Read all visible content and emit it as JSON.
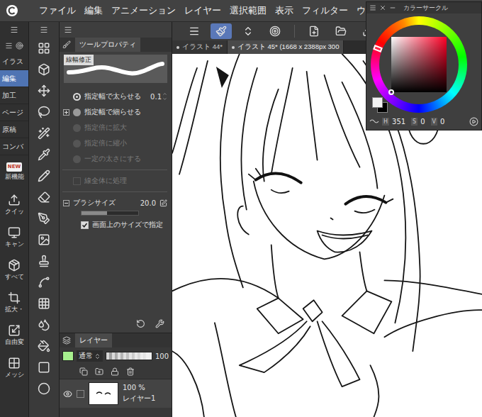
{
  "menu": {
    "items": [
      "ファイル",
      "編集",
      "アニメーション",
      "レイヤー",
      "選択範囲",
      "表示",
      "フィルター",
      "ウィ"
    ]
  },
  "nav": {
    "tabs": [
      {
        "label": "イラス",
        "selected": false
      },
      {
        "label": "編集",
        "selected": true
      },
      {
        "label": "加工",
        "selected": false
      },
      {
        "label": "ページ",
        "selected": false
      },
      {
        "label": "原稿",
        "selected": false
      },
      {
        "label": "コンバ",
        "selected": false
      }
    ],
    "items": [
      {
        "label": "新機能",
        "badge": "NEW"
      },
      {
        "label": "クイッ"
      },
      {
        "label": "キャン"
      },
      {
        "label": "すべて"
      },
      {
        "label": "拡大・"
      },
      {
        "label": "自由変"
      },
      {
        "label": "メッシ"
      }
    ]
  },
  "toolbar": {
    "buttons": [
      {
        "selected": false
      },
      {
        "selected": true
      },
      {
        "selected": false
      },
      {
        "selected": false
      },
      {
        "selected": false
      },
      {
        "selected": false
      },
      {
        "selected": false
      }
    ]
  },
  "documents": [
    {
      "label": "イラスト 44*",
      "selected": false
    },
    {
      "label": "イラスト 45* (1668 x 2388px 300",
      "selected": true
    }
  ],
  "tool_property": {
    "title": "ツールプロパティ",
    "preset": "線幅修正",
    "options": [
      {
        "kind": "radio",
        "label": "指定幅で太らせる",
        "selected": true,
        "disabled": false,
        "value": "0.1"
      },
      {
        "kind": "radio",
        "label": "指定幅で細らせる",
        "selected": false,
        "disabled": false,
        "expanded": false
      },
      {
        "kind": "radio",
        "label": "指定倍に拡大",
        "selected": false,
        "disabled": true
      },
      {
        "kind": "radio",
        "label": "指定倍に縮小",
        "selected": false,
        "disabled": true
      },
      {
        "kind": "radio",
        "label": "一定の太さにする",
        "selected": false,
        "disabled": true
      },
      {
        "kind": "checkbox",
        "label": "線全体に処理",
        "checked": false,
        "disabled": true
      },
      {
        "kind": "size",
        "label": "ブラシサイズ",
        "value": "20.0",
        "level": 0.45,
        "expanded": true
      },
      {
        "kind": "checkbox",
        "label": "画面上のサイズで指定",
        "checked": true,
        "disabled": false
      }
    ]
  },
  "layer_panel": {
    "title": "レイヤー",
    "blend": "通常",
    "opacity": "100",
    "opacity_level": 1,
    "layers": [
      {
        "opacity": "100 %",
        "name": "レイヤー1",
        "visible": true
      }
    ]
  },
  "color_circle": {
    "title": "カラーサークル",
    "readouts": [
      {
        "label": "H",
        "value": "351"
      },
      {
        "label": "S",
        "value": "0"
      },
      {
        "label": "V",
        "value": "0"
      }
    ]
  }
}
